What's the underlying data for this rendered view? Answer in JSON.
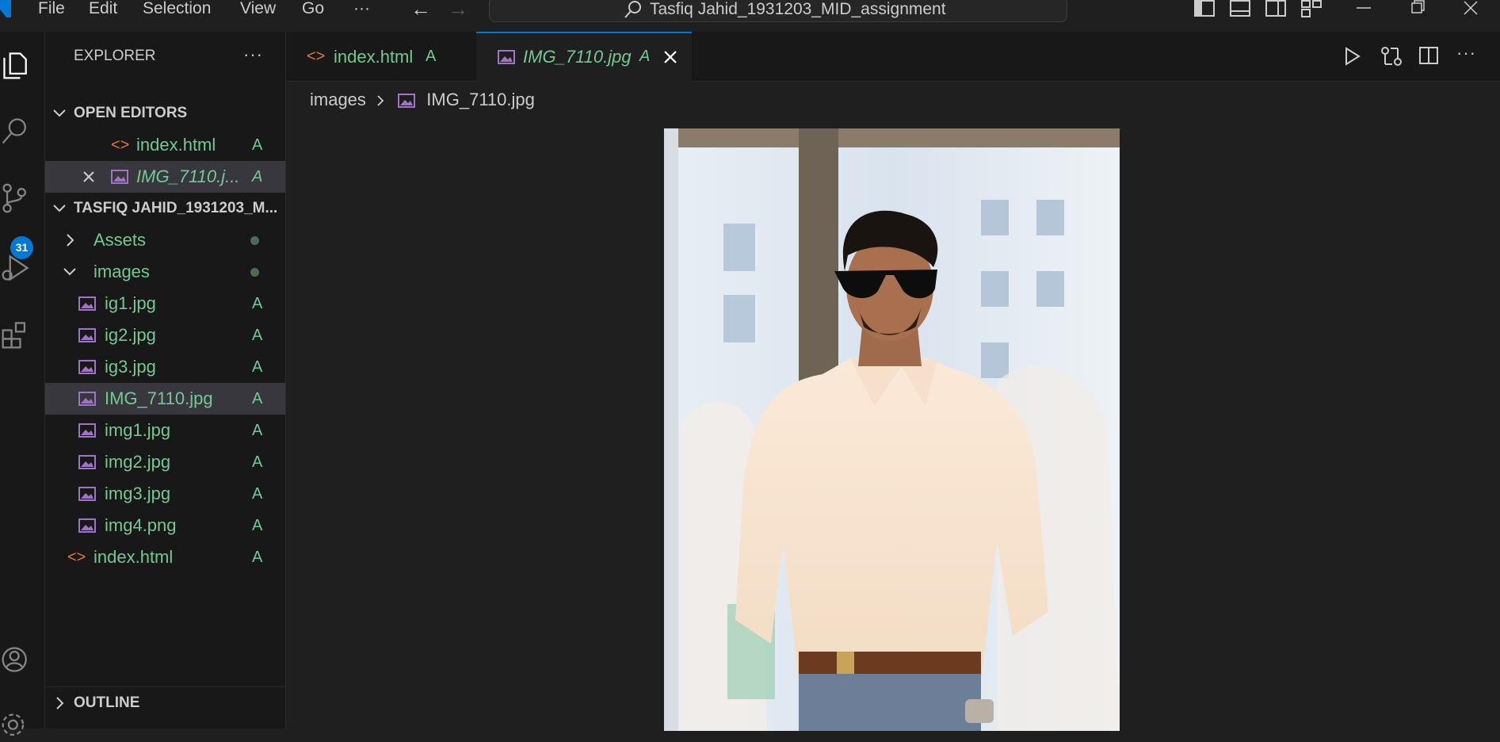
{
  "menu": {
    "file": "File",
    "edit": "Edit",
    "selection": "Selection",
    "view": "View",
    "go": "Go",
    "more": "···"
  },
  "search": {
    "text": "Tasfiq Jahid_1931203_MID_assignment"
  },
  "activity": {
    "scm_badge": "31"
  },
  "explorer": {
    "title": "EXPLORER",
    "more": "···",
    "open_editors": {
      "title": "OPEN EDITORS",
      "items": [
        {
          "label": "index.html",
          "status": "A"
        },
        {
          "label": "IMG_7110.j...",
          "status": "A"
        }
      ]
    },
    "folder": {
      "title": "TASFIQ JAHID_1931203_M...",
      "items": [
        {
          "label": "Assets"
        },
        {
          "label": "images"
        },
        {
          "label": "ig1.jpg",
          "status": "A"
        },
        {
          "label": "ig2.jpg",
          "status": "A"
        },
        {
          "label": "ig3.jpg",
          "status": "A"
        },
        {
          "label": "IMG_7110.jpg",
          "status": "A"
        },
        {
          "label": "img1.jpg",
          "status": "A"
        },
        {
          "label": "img2.jpg",
          "status": "A"
        },
        {
          "label": "img3.jpg",
          "status": "A"
        },
        {
          "label": "img4.png",
          "status": "A"
        },
        {
          "label": "index.html",
          "status": "A"
        }
      ]
    },
    "outline": "OUTLINE"
  },
  "tabs": [
    {
      "label": "index.html",
      "status": "A"
    },
    {
      "label": "IMG_7110.jpg",
      "status": "A"
    }
  ],
  "breadcrumb": {
    "folder": "images",
    "file": "IMG_7110.jpg"
  },
  "colors": {
    "accent": "#0078d4",
    "git_added": "#73c991",
    "html_icon": "#e37933",
    "image_icon": "#a074c4"
  }
}
